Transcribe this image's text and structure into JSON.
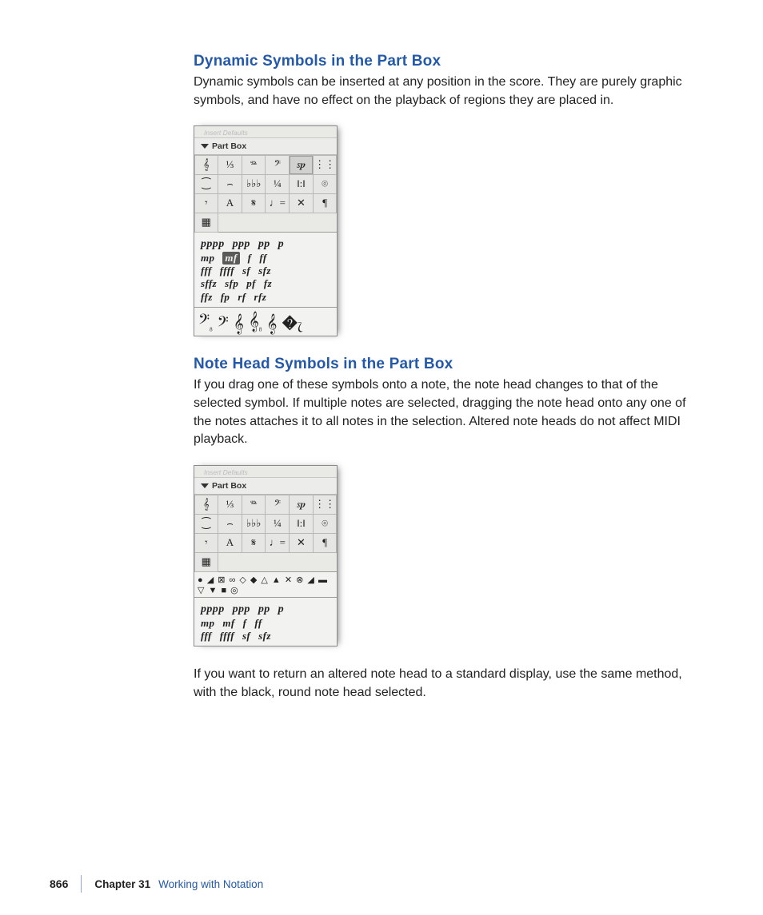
{
  "heading1": "Dynamic Symbols in the Part Box",
  "para1": "Dynamic symbols can be inserted at any position in the score. They are purely graphic symbols, and have no effect on the playback of regions they are placed in.",
  "heading2": "Note Head Symbols in the Part Box",
  "para2": "If you drag one of these symbols onto a note, the note head changes to that of the selected symbol. If multiple notes are selected, dragging the note head onto any one of the notes attaches it to all notes in the selection. Altered note heads do not affect MIDI playback.",
  "para3": "If you want to return an altered note head to a standard display, use the same method, with the black, round note head selected.",
  "partbox": {
    "header": "Insert Defaults",
    "title": "Part Box",
    "grid": [
      "𝄞",
      "⅓",
      "𝆮",
      "𝄢",
      "𝆍𝆏",
      "⋮⋮",
      "⁐",
      "⌢",
      "♭♭♭",
      "¼",
      "‖:‖",
      "⌾",
      "𝄾",
      "A",
      "𝄋",
      "♩=",
      "✕",
      "¶",
      "▦"
    ],
    "dyn_rows": [
      [
        "pppp",
        "ppp",
        "pp",
        "p"
      ],
      [
        "mp",
        "mf",
        "f",
        "ff"
      ],
      [
        "fff",
        "ffff",
        "sf",
        "sfz"
      ],
      [
        "sffz",
        "sfp",
        "pf",
        "fz"
      ],
      [
        "ffz",
        "fp",
        "rf",
        "rfz"
      ]
    ],
    "clefs": [
      "𝄢",
      "𝄢",
      "𝄞",
      "𝄞",
      "𝄞",
      "�ැ"
    ],
    "noteheads_line1": "● ◢ ⊠ ∞ ◇ ◆ △ ▲ ✕ ⊗ ◢ ▬",
    "noteheads_line2": "▽ ▼ ■ ◎",
    "dyn_rows_short": [
      [
        "pppp",
        "ppp",
        "pp",
        "p"
      ],
      [
        "mp",
        "mf",
        "f",
        "ff"
      ],
      [
        "fff",
        "ffff",
        "sf",
        "sfz"
      ]
    ]
  },
  "footer": {
    "pagenum": "866",
    "chapter": "Chapter 31",
    "title": "Working with Notation"
  }
}
